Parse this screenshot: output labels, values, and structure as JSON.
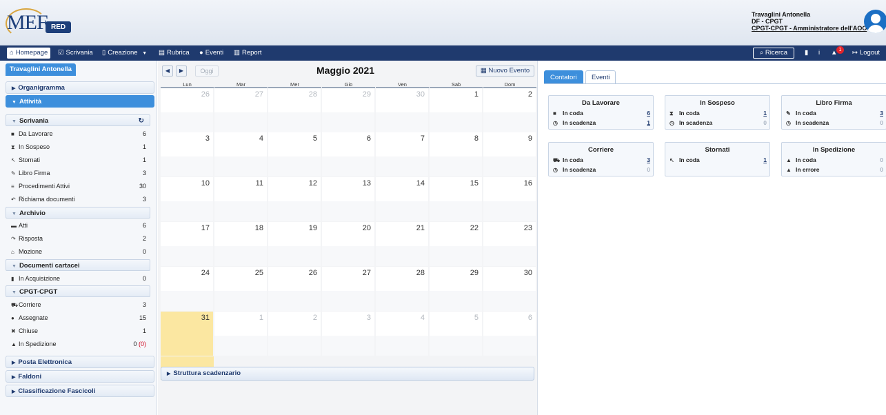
{
  "header": {
    "logo_text": "MEF",
    "logo_badge": "RED",
    "user_name": "Travaglini Antonella",
    "user_dept": "DF - CPGT",
    "user_role": "CPGT-CPGT - Amministratore dell'AOO"
  },
  "navbar": {
    "items": [
      {
        "label": "Homepage",
        "icon": "home-icon"
      },
      {
        "label": "Scrivania",
        "icon": "check-square-icon"
      },
      {
        "label": "Creazione",
        "icon": "file-icon"
      },
      {
        "label": "Rubrica",
        "icon": "address-book-icon"
      },
      {
        "label": "Eventi",
        "icon": "dot-icon"
      },
      {
        "label": "Report",
        "icon": "bar-chart-icon"
      }
    ],
    "search_label": "Ricerca",
    "notifications_count": "1",
    "logout_label": "Logout"
  },
  "sidebar": {
    "user_tab": "Travaglini Antonella",
    "sections": {
      "organigramma": "Organigramma",
      "attivita": "Attività",
      "posta": "Posta Elettronica",
      "faldoni": "Faldoni",
      "classificazione": "Classificazione Fascicoli"
    },
    "scrivania": {
      "title": "Scrivania",
      "items": [
        {
          "label": "Da Lavorare",
          "count": "6",
          "icon": "briefcase-icon"
        },
        {
          "label": "In Sospeso",
          "count": "1",
          "icon": "hourglass-icon"
        },
        {
          "label": "Stornati",
          "count": "1",
          "icon": "undo-icon"
        },
        {
          "label": "Libro Firma",
          "count": "3",
          "icon": "edit-icon"
        },
        {
          "label": "Procedimenti Attivi",
          "count": "30",
          "icon": "list-icon"
        },
        {
          "label": "Richiama documenti",
          "count": "3",
          "icon": "reply-icon"
        }
      ]
    },
    "archivio": {
      "title": "Archivio",
      "items": [
        {
          "label": "Atti",
          "count": "6",
          "icon": "archive-icon"
        },
        {
          "label": "Risposta",
          "count": "2",
          "icon": "forward-icon"
        },
        {
          "label": "Mozione",
          "count": "0",
          "icon": "bank-icon"
        }
      ]
    },
    "cartacei": {
      "title": "Documenti cartacei",
      "items": [
        {
          "label": "In Acquisizione",
          "count": "0",
          "icon": "document-icon"
        }
      ]
    },
    "cpgt": {
      "title": "CPGT-CPGT",
      "items": [
        {
          "label": "Corriere",
          "count": "3",
          "icon": "truck-icon"
        },
        {
          "label": "Assegnate",
          "count": "15",
          "icon": "user-icon"
        },
        {
          "label": "Chiuse",
          "count": "1",
          "icon": "close-icon"
        },
        {
          "label": "In Spedizione",
          "count": "0",
          "count_error": "(0)",
          "icon": "binoculars-icon"
        }
      ]
    }
  },
  "calendar": {
    "today_label": "Oggi",
    "title": "Maggio 2021",
    "new_event_label": "Nuovo Evento",
    "weekdays": [
      "Lun",
      "Mar",
      "Mer",
      "Gio",
      "Ven",
      "Sab",
      "Dom"
    ],
    "weeks": [
      [
        "26",
        "27",
        "28",
        "29",
        "30",
        "1",
        "2"
      ],
      [
        "3",
        "4",
        "5",
        "6",
        "7",
        "8",
        "9"
      ],
      [
        "10",
        "11",
        "12",
        "13",
        "14",
        "15",
        "16"
      ],
      [
        "17",
        "18",
        "19",
        "20",
        "21",
        "22",
        "23"
      ],
      [
        "24",
        "25",
        "26",
        "27",
        "28",
        "29",
        "30"
      ],
      [
        "31",
        "1",
        "2",
        "3",
        "4",
        "5",
        "6"
      ]
    ],
    "struttura_label": "Struttura scadenzario"
  },
  "right_panel": {
    "tabs": [
      "Contatori",
      "Eventi"
    ],
    "boxes": [
      {
        "title": "Da Lavorare",
        "rows": [
          {
            "label": "In coda",
            "value": "6",
            "icon": "briefcase-icon"
          },
          {
            "label": "In scadenza",
            "value": "1",
            "icon": "clock-icon"
          }
        ]
      },
      {
        "title": "In Sospeso",
        "rows": [
          {
            "label": "In coda",
            "value": "1",
            "icon": "hourglass-icon"
          },
          {
            "label": "In scadenza",
            "value": "0",
            "icon": "clock-icon"
          }
        ]
      },
      {
        "title": "Libro Firma",
        "rows": [
          {
            "label": "In coda",
            "value": "3",
            "icon": "edit-icon"
          },
          {
            "label": "In scadenza",
            "value": "0",
            "icon": "clock-icon"
          }
        ]
      },
      {
        "title": "Corriere",
        "rows": [
          {
            "label": "In coda",
            "value": "3",
            "icon": "truck-icon"
          },
          {
            "label": "In scadenza",
            "value": "0",
            "icon": "clock-icon"
          }
        ]
      },
      {
        "title": "Stornati",
        "rows": [
          {
            "label": "In coda",
            "value": "1",
            "icon": "undo-icon"
          }
        ]
      },
      {
        "title": "In Spedizione",
        "rows": [
          {
            "label": "In coda",
            "value": "0",
            "icon": "binoculars-icon"
          },
          {
            "label": "In errore",
            "value": "0",
            "icon": "warning-icon"
          }
        ]
      }
    ]
  }
}
